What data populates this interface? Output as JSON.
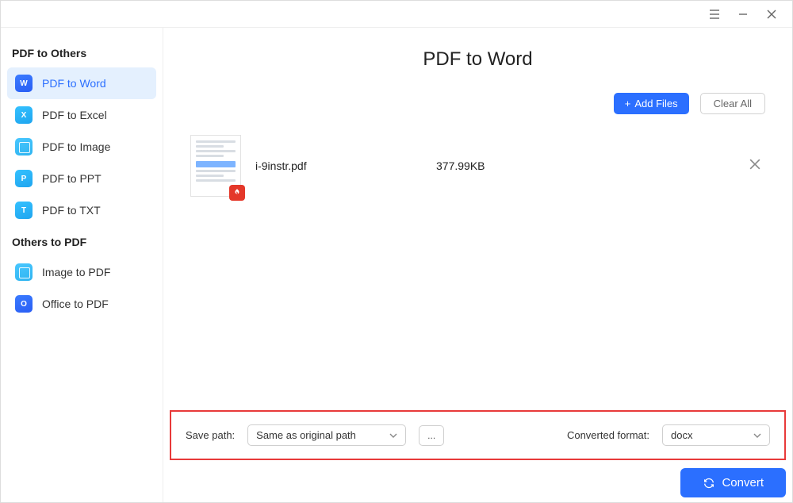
{
  "sidebar": {
    "section1_title": "PDF to Others",
    "items1": [
      {
        "label": "PDF to Word",
        "icon_text": "W"
      },
      {
        "label": "PDF to Excel",
        "icon_text": "X"
      },
      {
        "label": "PDF to Image",
        "icon_text": ""
      },
      {
        "label": "PDF to PPT",
        "icon_text": "P"
      },
      {
        "label": "PDF to TXT",
        "icon_text": "T"
      }
    ],
    "section2_title": "Others to PDF",
    "items2": [
      {
        "label": "Image to PDF",
        "icon_text": ""
      },
      {
        "label": "Office to PDF",
        "icon_text": "O"
      }
    ]
  },
  "main": {
    "title": "PDF to Word",
    "add_files_label": "Add Files",
    "clear_all_label": "Clear All",
    "file": {
      "name": "i-9instr.pdf",
      "size": "377.99KB"
    },
    "save_path_label": "Save path:",
    "save_path_value": "Same as original path",
    "browse_label": "...",
    "format_label": "Converted format:",
    "format_value": "docx",
    "convert_label": "Convert"
  }
}
